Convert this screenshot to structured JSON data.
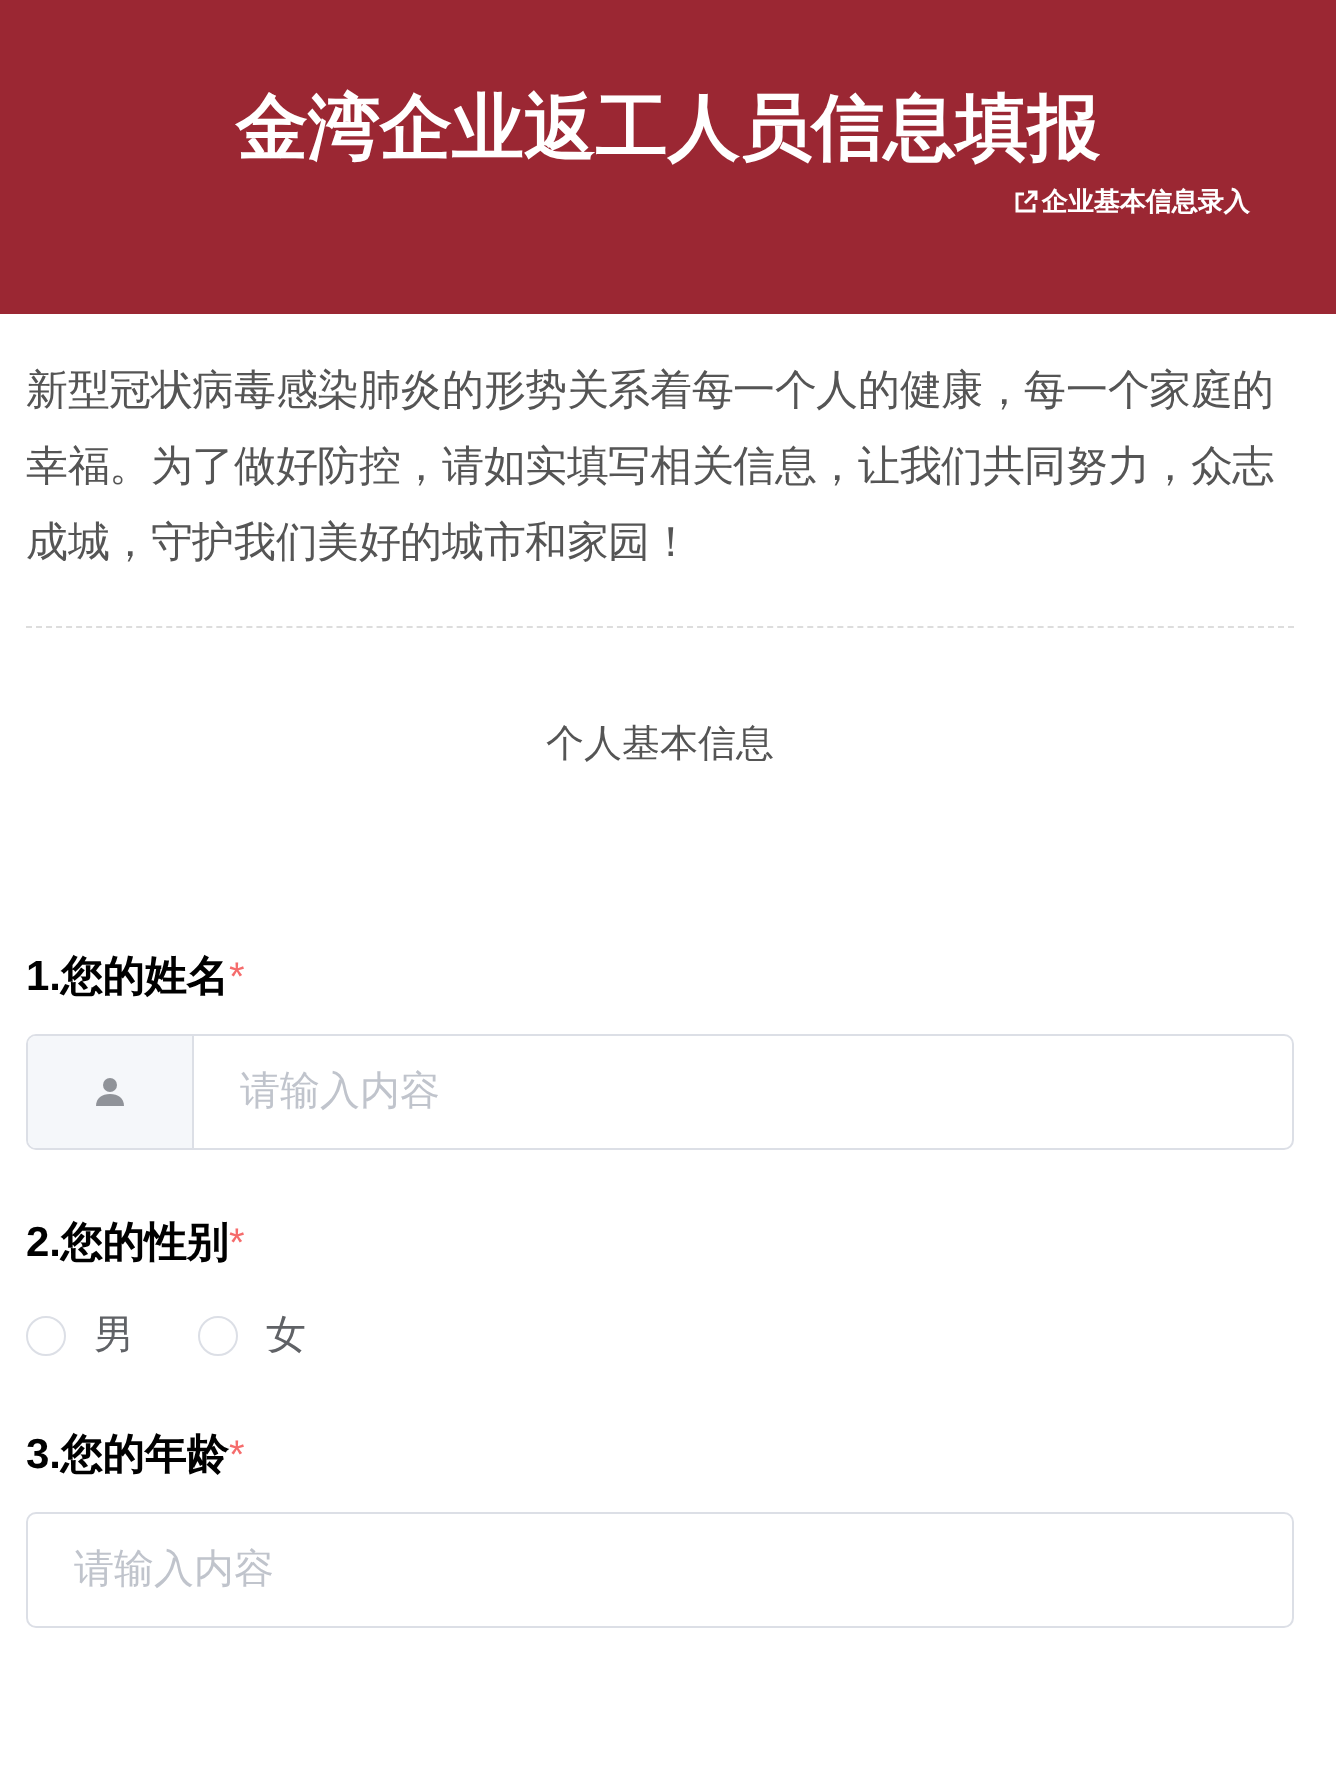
{
  "header": {
    "title": "金湾企业返工人员信息填报",
    "link": "企业基本信息录入"
  },
  "intro": "新型冠状病毒感染肺炎的形势关系着每一个人的健康，每一个家庭的幸福。为了做好防控，请如实填写相关信息，让我们共同努力，众志成城，守护我们美好的城市和家园！",
  "section_title": "个人基本信息",
  "questions": [
    {
      "kind": "icon-input",
      "label": "1.您的姓名",
      "required_mark": "*",
      "placeholder": "请输入内容"
    },
    {
      "kind": "radio",
      "label": "2.您的性别",
      "required_mark": "*",
      "options": [
        {
          "label": "男",
          "selected": false
        },
        {
          "label": "女",
          "selected": false
        }
      ]
    },
    {
      "kind": "input",
      "label": "3.您的年龄",
      "required_mark": "*",
      "placeholder": "请输入内容"
    }
  ]
}
